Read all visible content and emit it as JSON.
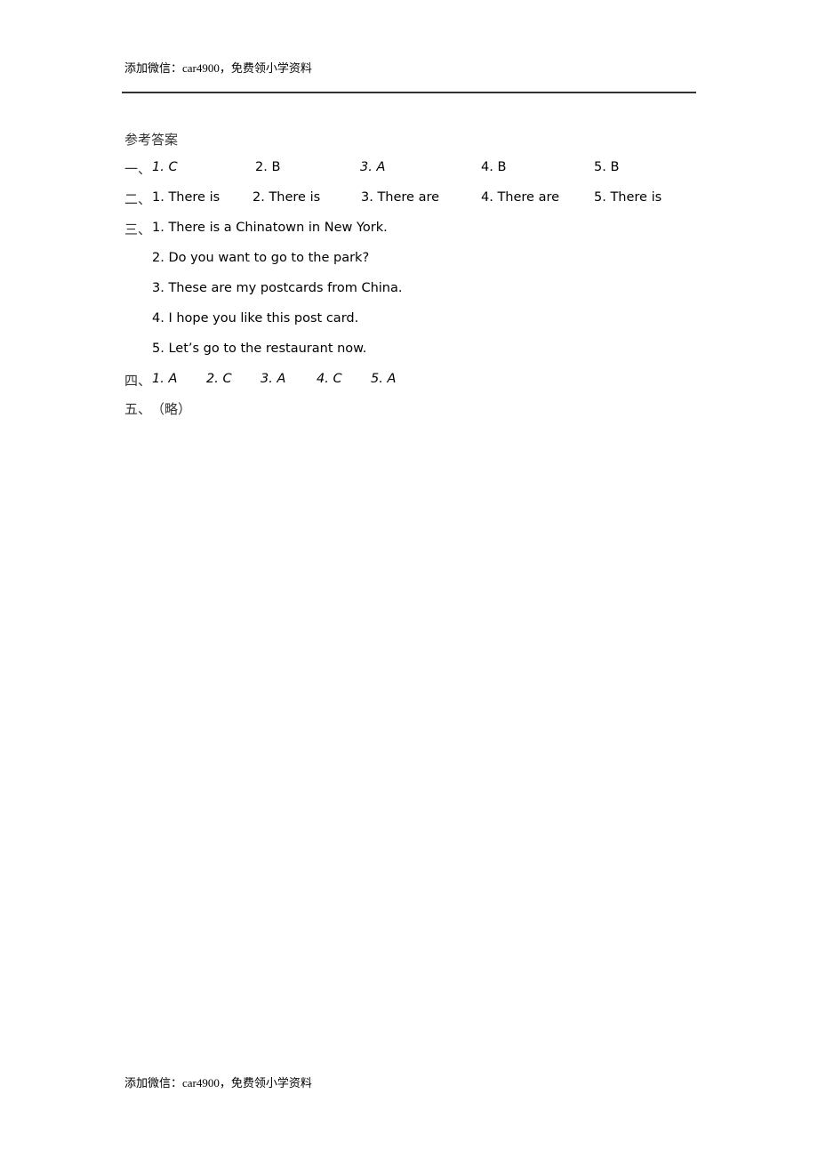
{
  "header": {
    "text": "添加微信：car4900，免费领小学资料"
  },
  "footer": {
    "text": "添加微信：car4900，免费领小学资料"
  },
  "title": "参考答案",
  "section1": {
    "label": "一、",
    "answers": [
      "1. C",
      "2. B",
      "3. A",
      "4. B",
      "5. B"
    ]
  },
  "section2": {
    "label": "二、",
    "answers": [
      "1. There is",
      "2. There is",
      "3. There are",
      "4. There are",
      "5. There is"
    ]
  },
  "section3": {
    "label": "三、",
    "answers": [
      "1. There is a Chinatown in New York.",
      "2. Do you want to go to the park?",
      "3. These are my postcards from China.",
      "4. I hope you like this post card.",
      "5. Let’s go to the restaurant now."
    ]
  },
  "section4": {
    "label": "四、",
    "answers": [
      "1. A",
      "2. C",
      "3. A",
      "4. C",
      "5. A"
    ]
  },
  "section5": {
    "label": "五、",
    "text": "（略）"
  }
}
